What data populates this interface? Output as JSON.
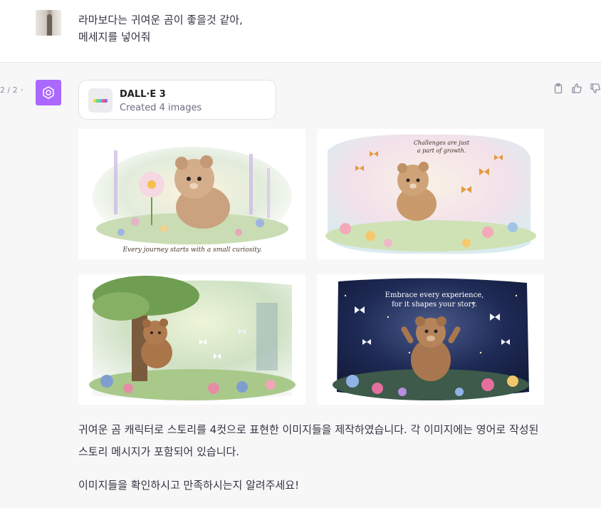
{
  "user_message": {
    "line1": "라마보다는 귀여운 곰이 좋을것 같아,",
    "line2": "메세지를 넣어줘"
  },
  "assistant": {
    "pager": {
      "current": "2 / 2"
    },
    "tool": {
      "name": "DALL·E 3",
      "status": "Created 4 images"
    },
    "images": [
      {
        "caption": "Every journey starts with a small curiosity."
      },
      {
        "caption_line1": "Challenges are just",
        "caption_line2": "a part of growth."
      },
      {
        "caption": ""
      },
      {
        "caption_line1": "Embrace every experience,",
        "caption_line2": "for it shapes your story."
      }
    ],
    "message": {
      "paragraph1": "귀여운 곰 캐릭터로 스토리를 4컷으로 표현한 이미지들을 제작하였습니다. 각 이미지에는 영어로 작성된 스토리 메시지가 포함되어 있습니다.",
      "paragraph2": "이미지들을 확인하시고 만족하시는지 알려주세요!"
    }
  },
  "colors": {
    "gpt_avatar": "#ab68ff",
    "background": "#f7f7f8",
    "text": "#343541"
  },
  "icons": [
    "chevron-right-icon",
    "openai-logo-icon",
    "clipboard-icon",
    "thumbs-up-icon",
    "thumbs-down-icon"
  ]
}
